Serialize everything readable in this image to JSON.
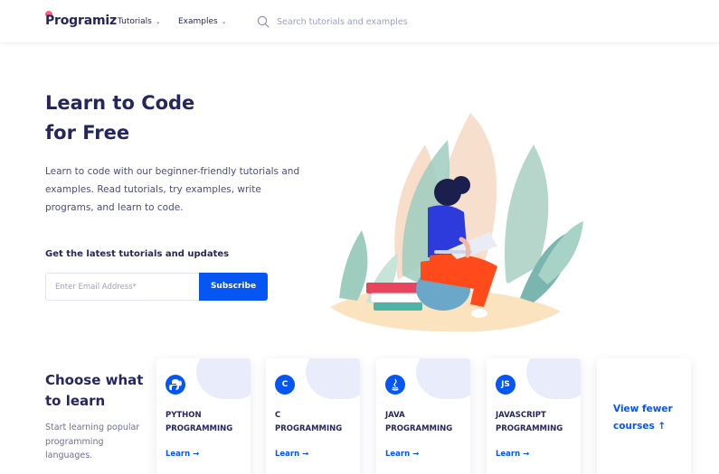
{
  "header": {
    "logo": "Programiz",
    "nav": [
      {
        "label": "Tutorials"
      },
      {
        "label": "Examples"
      }
    ],
    "search_placeholder": "Search tutorials and examples"
  },
  "hero": {
    "title_line1": "Learn to Code",
    "title_line2": "for Free",
    "description": "Learn to code with our beginner-friendly tutorials and examples. Read tutorials, try examples, write programs, and learn to code.",
    "updates_label": "Get the latest tutorials and updates",
    "email_placeholder": "Enter Email Address*",
    "subscribe_label": "Subscribe"
  },
  "courses": {
    "title_line1": "Choose what",
    "title_line2": "to learn",
    "description": "Start learning popular programming languages.",
    "cards": [
      {
        "icon": "python-icon",
        "line1": "PYTHON",
        "line2": "PROGRAMMING",
        "learn": "Learn →"
      },
      {
        "icon": "c-icon",
        "icon_text": "C",
        "line1": "C",
        "line2": "PROGRAMMING",
        "learn": "Learn →"
      },
      {
        "icon": "java-icon",
        "line1": "JAVA",
        "line2": "PROGRAMMING",
        "learn": "Learn →"
      },
      {
        "icon": "javascript-icon",
        "icon_text": "JS",
        "line1": "JAVASCRIPT",
        "line2": "PROGRAMMING",
        "learn": "Learn →"
      }
    ],
    "view_fewer_line1": "View fewer",
    "view_fewer_line2": "courses ↑"
  },
  "colors": {
    "brand_blue": "#0556f3",
    "text_dark": "#25265e",
    "accent_orange": "#ff4a1c"
  }
}
